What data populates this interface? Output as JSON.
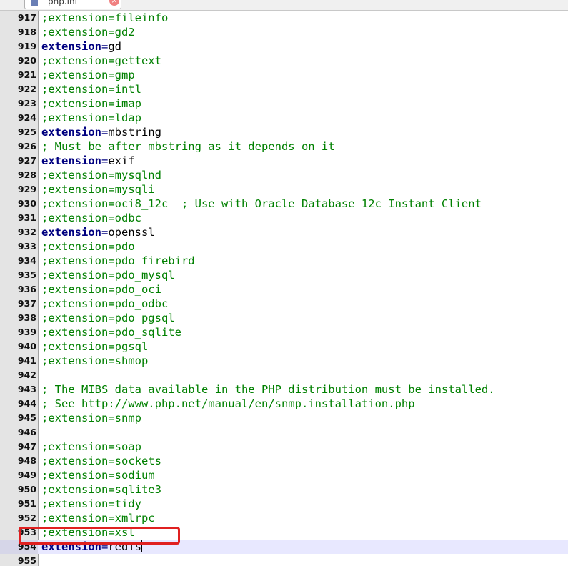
{
  "tab": {
    "label": "php.ini",
    "close_glyph": "×",
    "icon": "file-icon"
  },
  "editor": {
    "lines": [
      {
        "num": "917",
        "type": "comment",
        "text": ";extension=fileinfo"
      },
      {
        "num": "918",
        "type": "comment",
        "text": ";extension=gd2"
      },
      {
        "num": "919",
        "type": "directive",
        "key": "extension",
        "eq": "=",
        "value": "gd"
      },
      {
        "num": "920",
        "type": "comment",
        "text": ";extension=gettext"
      },
      {
        "num": "921",
        "type": "comment",
        "text": ";extension=gmp"
      },
      {
        "num": "922",
        "type": "comment",
        "text": ";extension=intl"
      },
      {
        "num": "923",
        "type": "comment",
        "text": ";extension=imap"
      },
      {
        "num": "924",
        "type": "comment",
        "text": ";extension=ldap"
      },
      {
        "num": "925",
        "type": "directive",
        "key": "extension",
        "eq": "=",
        "value": "mbstring"
      },
      {
        "num": "926",
        "type": "comment",
        "text": "; Must be after mbstring as it depends on it"
      },
      {
        "num": "927",
        "type": "directive",
        "key": "extension",
        "eq": "=",
        "value": "exif"
      },
      {
        "num": "928",
        "type": "comment",
        "text": ";extension=mysqlnd"
      },
      {
        "num": "929",
        "type": "comment",
        "text": ";extension=mysqli"
      },
      {
        "num": "930",
        "type": "comment",
        "text": ";extension=oci8_12c  ; Use with Oracle Database 12c Instant Client"
      },
      {
        "num": "931",
        "type": "comment",
        "text": ";extension=odbc"
      },
      {
        "num": "932",
        "type": "directive",
        "key": "extension",
        "eq": "=",
        "value": "openssl"
      },
      {
        "num": "933",
        "type": "comment",
        "text": ";extension=pdo"
      },
      {
        "num": "934",
        "type": "comment",
        "text": ";extension=pdo_firebird"
      },
      {
        "num": "935",
        "type": "comment",
        "text": ";extension=pdo_mysql"
      },
      {
        "num": "936",
        "type": "comment",
        "text": ";extension=pdo_oci"
      },
      {
        "num": "937",
        "type": "comment",
        "text": ";extension=pdo_odbc"
      },
      {
        "num": "938",
        "type": "comment",
        "text": ";extension=pdo_pgsql"
      },
      {
        "num": "939",
        "type": "comment",
        "text": ";extension=pdo_sqlite"
      },
      {
        "num": "940",
        "type": "comment",
        "text": ";extension=pgsql"
      },
      {
        "num": "941",
        "type": "comment",
        "text": ";extension=shmop"
      },
      {
        "num": "942",
        "type": "empty",
        "text": ""
      },
      {
        "num": "943",
        "type": "comment",
        "text": "; The MIBS data available in the PHP distribution must be installed."
      },
      {
        "num": "944",
        "type": "comment",
        "text": "; See http://www.php.net/manual/en/snmp.installation.php"
      },
      {
        "num": "945",
        "type": "comment",
        "text": ";extension=snmp"
      },
      {
        "num": "946",
        "type": "empty",
        "text": ""
      },
      {
        "num": "947",
        "type": "comment",
        "text": ";extension=soap"
      },
      {
        "num": "948",
        "type": "comment",
        "text": ";extension=sockets"
      },
      {
        "num": "949",
        "type": "comment",
        "text": ";extension=sodium"
      },
      {
        "num": "950",
        "type": "comment",
        "text": ";extension=sqlite3"
      },
      {
        "num": "951",
        "type": "comment",
        "text": ";extension=tidy"
      },
      {
        "num": "952",
        "type": "comment",
        "text": ";extension=xmlrpc"
      },
      {
        "num": "953",
        "type": "comment",
        "text": ";extension=xsl"
      },
      {
        "num": "954",
        "type": "directive",
        "key": "extension",
        "eq": "=",
        "value": "redis",
        "current": true
      },
      {
        "num": "955",
        "type": "empty",
        "text": ""
      }
    ]
  },
  "colors": {
    "comment": "#008000",
    "keyword": "#000080",
    "current_line": "#e8e8ff",
    "highlight_box": "#e02020",
    "gutter": "#e4e4e4"
  }
}
